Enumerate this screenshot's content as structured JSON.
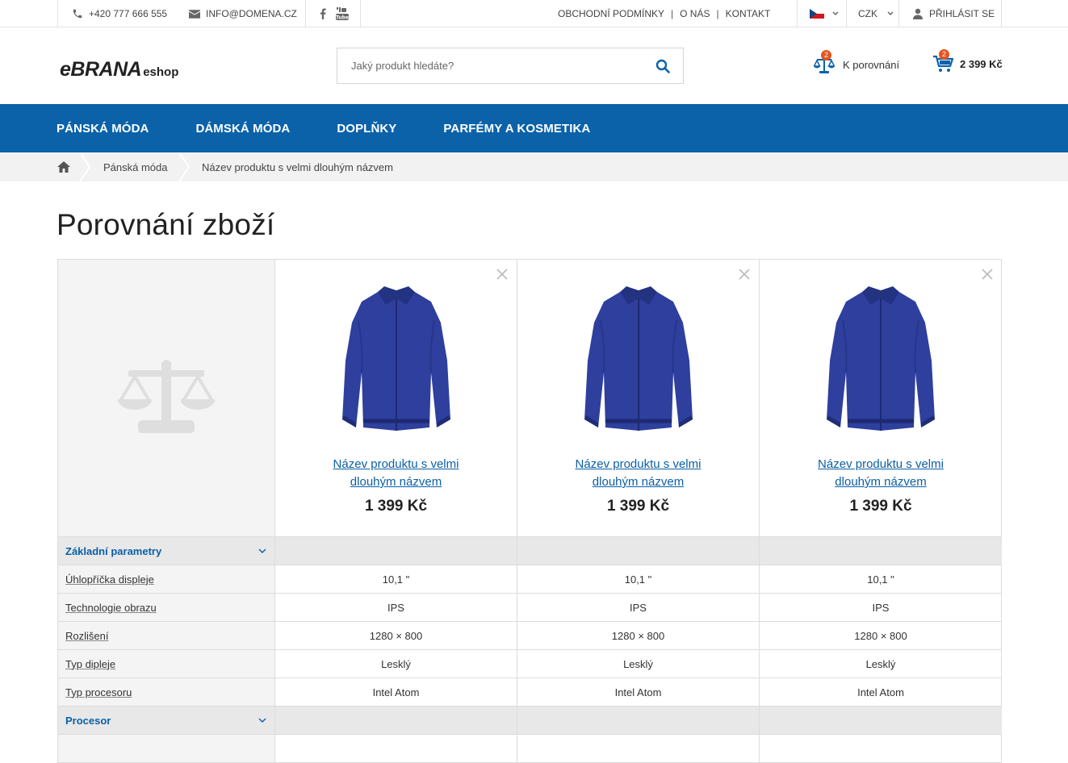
{
  "topbar": {
    "phone": "+420 777 666 555",
    "email": "INFO@DOMENA.CZ",
    "links": [
      "OBCHODNÍ PODMÍNKY",
      "O NÁS",
      "KONTAKT"
    ],
    "currency": "CZK",
    "login": "PŘIHLÁSIT SE"
  },
  "header": {
    "logo_main": "eBRANA",
    "logo_sub": "eshop",
    "search_placeholder": "Jaký produkt hledáte?",
    "compare_label": "K porovnání",
    "compare_count": "2",
    "cart_count": "2",
    "cart_price": "2 399 Kč"
  },
  "nav": [
    "PÁNSKÁ MÓDA",
    "DÁMSKÁ MÓDA",
    "DOPLŇKY",
    "PARFÉMY A KOSMETIKA"
  ],
  "breadcrumb": [
    "Pánská móda",
    "Název produktu s velmi dlouhým názvem"
  ],
  "page_title": "Porovnání zboží",
  "products": [
    {
      "name": "Název produktu s velmi dlouhým názvem",
      "price": "1 399 Kč"
    },
    {
      "name": "Název produktu s velmi dlouhým názvem",
      "price": "1 399 Kč"
    },
    {
      "name": "Název produktu s velmi dlouhým názvem",
      "price": "1 399 Kč"
    }
  ],
  "groups": [
    {
      "title": "Základní parametry",
      "params": [
        {
          "label": "Úhlopříčka displeje",
          "values": [
            "10,1 \"",
            "10,1 \"",
            "10,1 \""
          ]
        },
        {
          "label": "Technologie obrazu",
          "values": [
            "IPS",
            "IPS",
            "IPS"
          ]
        },
        {
          "label": "Rozlišení",
          "values": [
            "1280 × 800",
            "1280 × 800",
            "1280 × 800"
          ]
        },
        {
          "label": "Typ dipleje",
          "values": [
            "Lesklý",
            "Lesklý",
            "Lesklý"
          ]
        },
        {
          "label": "Typ procesoru",
          "values": [
            "Intel Atom",
            "Intel Atom",
            "Intel Atom"
          ]
        }
      ]
    },
    {
      "title": "Procesor",
      "params": []
    }
  ],
  "colors": {
    "brand_blue": "#0b62a9",
    "link_blue": "#0b5fa5",
    "badge_orange": "#e4541f"
  }
}
